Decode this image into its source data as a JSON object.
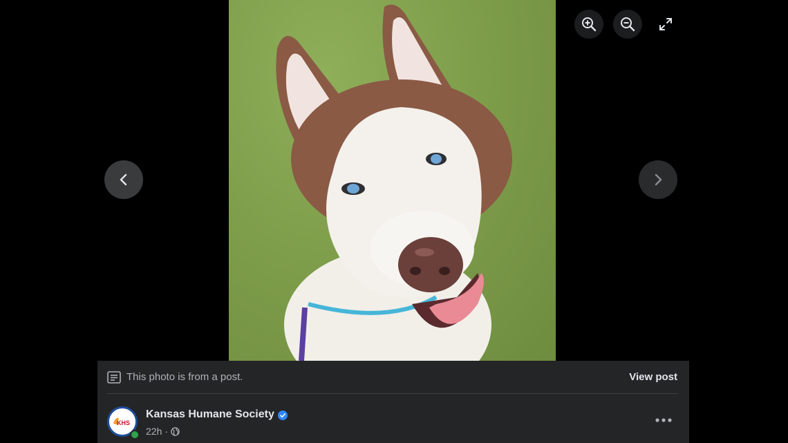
{
  "photo": {
    "alt": "Husky dog photo"
  },
  "controls": {
    "zoom_in": "zoom-in-icon",
    "zoom_out": "zoom-out-icon",
    "fullscreen": "fullscreen-icon",
    "previous": "chevron-left-icon",
    "next": "chevron-right-icon"
  },
  "post_note": {
    "text": "This photo is from a post.",
    "view_post_label": "View post"
  },
  "author": {
    "name": "Kansas Humane Society",
    "verified": true,
    "time": "22h",
    "separator": "·",
    "audience_icon": "globe-icon",
    "avatar_text": "KHS"
  },
  "colors": {
    "verified_blue": "#2d88ff",
    "online_green": "#31a24c",
    "panel_bg": "#242526"
  }
}
